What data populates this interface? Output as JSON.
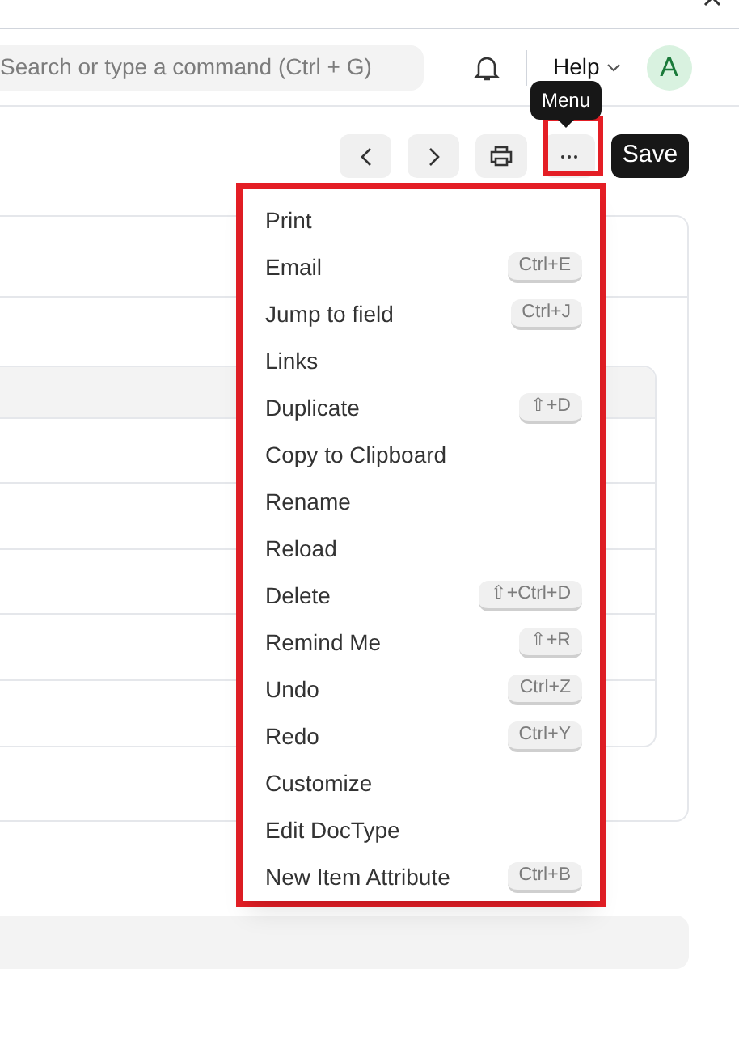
{
  "navbar": {
    "search": {
      "placeholder": "Search or type a command (Ctrl + G)"
    },
    "help": "Help",
    "avatar": "A"
  },
  "toolbar": {
    "tooltip": "Menu",
    "save": "Save"
  },
  "menu": [
    {
      "label": "Print"
    },
    {
      "label": "Email",
      "shortcut": "Ctrl+E"
    },
    {
      "label": "Jump to field",
      "shortcut": "Ctrl+J"
    },
    {
      "label": "Links"
    },
    {
      "label": "Duplicate",
      "shortcut": "⇧+D"
    },
    {
      "label": "Copy to Clipboard"
    },
    {
      "label": "Rename"
    },
    {
      "label": "Reload"
    },
    {
      "label": "Delete",
      "shortcut": "⇧+Ctrl+D"
    },
    {
      "label": "Remind Me",
      "shortcut": "⇧+R"
    },
    {
      "label": "Undo",
      "shortcut": "Ctrl+Z"
    },
    {
      "label": "Redo",
      "shortcut": "Ctrl+Y"
    },
    {
      "label": "Customize"
    },
    {
      "label": "Edit DocType"
    },
    {
      "label": "New Item Attribute",
      "shortcut": "Ctrl+B"
    }
  ]
}
